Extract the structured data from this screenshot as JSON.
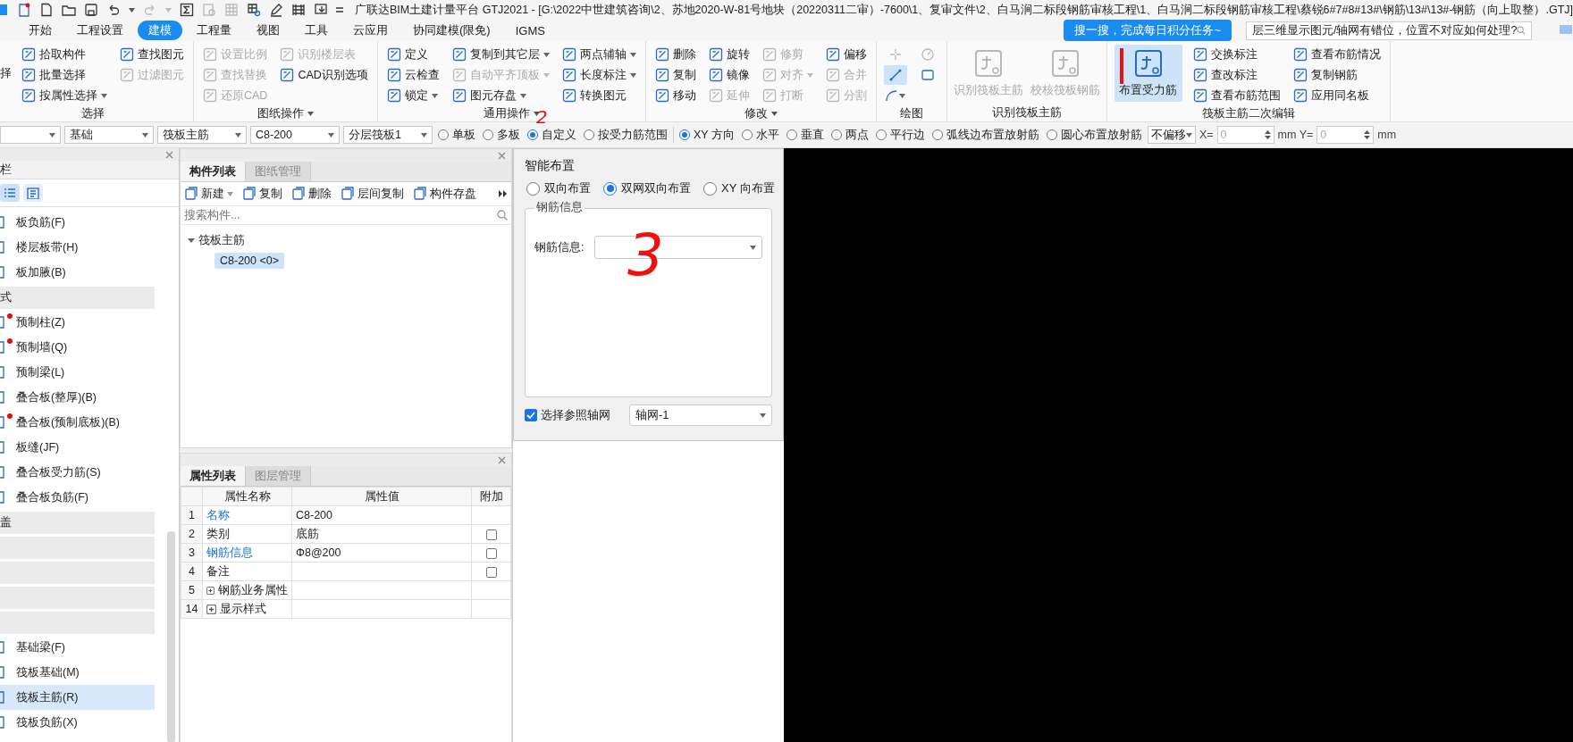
{
  "window": {
    "title": "广联达BIM土建计量平台 GTJ2021 - [G:\\2022中世建筑咨询\\2、苏地2020-W-81号地块（20220311二审）-7600\\1、复审文件\\2、白马涧二标段钢筋审核工程\\1、白马涧二标段钢筋审核工程\\蔡锐6#7#8#13#\\钢筋\\13#\\13#-钢筋（向上取整）.GTJ]"
  },
  "menu_tabs": [
    {
      "label": "开始",
      "selected": false
    },
    {
      "label": "工程设置",
      "selected": false
    },
    {
      "label": "建模",
      "selected": true
    },
    {
      "label": "工程量",
      "selected": false
    },
    {
      "label": "视图",
      "selected": false
    },
    {
      "label": "工具",
      "selected": false
    },
    {
      "label": "云应用",
      "selected": false
    },
    {
      "label": "协同建模(限免)",
      "selected": false
    },
    {
      "label": "IGMS",
      "selected": false
    }
  ],
  "tooltip": "搜一搜，完成每日积分任务~",
  "help_search": {
    "value": "层三维显示图元/轴网有错位，位置不对应如何处理?"
  },
  "ribbon": {
    "groups": [
      {
        "label": "选择",
        "menu": false,
        "columns": [
          [
            {
              "kind": "edge",
              "label": "择"
            }
          ],
          [
            {
              "kind": "small",
              "label": "拾取构件",
              "disabled": false,
              "dropdown": false
            },
            {
              "kind": "small",
              "label": "批量选择",
              "disabled": false,
              "dropdown": false
            },
            {
              "kind": "small",
              "label": "按属性选择",
              "disabled": false,
              "dropdown": true
            }
          ],
          [
            {
              "kind": "small",
              "label": "查找图元",
              "disabled": false,
              "dropdown": false
            },
            {
              "kind": "small",
              "label": "过滤图元",
              "disabled": true,
              "dropdown": false
            }
          ]
        ]
      },
      {
        "label": "图纸操作",
        "menu": true,
        "columns": [
          [
            {
              "kind": "small",
              "label": "设置比例",
              "disabled": true,
              "dropdown": false
            },
            {
              "kind": "small",
              "label": "查找替换",
              "disabled": true,
              "dropdown": false
            },
            {
              "kind": "small",
              "label": "还原CAD",
              "disabled": true,
              "dropdown": false
            }
          ],
          [
            {
              "kind": "small",
              "label": "识别楼层表",
              "disabled": true,
              "dropdown": false
            },
            {
              "kind": "small",
              "label": "CAD识别选项",
              "disabled": false,
              "dropdown": false
            }
          ]
        ]
      },
      {
        "label": "通用操作",
        "menu": true,
        "columns": [
          [
            {
              "kind": "small",
              "label": "定义",
              "disabled": false,
              "dropdown": false
            },
            {
              "kind": "small",
              "label": "云检查",
              "disabled": false,
              "dropdown": false
            },
            {
              "kind": "small",
              "label": "锁定",
              "disabled": false,
              "dropdown": true
            }
          ],
          [
            {
              "kind": "small",
              "label": "复制到其它层",
              "disabled": false,
              "dropdown": true
            },
            {
              "kind": "small",
              "label": "自动平齐顶板",
              "disabled": true,
              "dropdown": true
            },
            {
              "kind": "small",
              "label": "图元存盘",
              "disabled": false,
              "dropdown": true
            }
          ],
          [
            {
              "kind": "small",
              "label": "两点辅轴",
              "disabled": false,
              "dropdown": true
            },
            {
              "kind": "small",
              "label": "长度标注",
              "disabled": false,
              "dropdown": true
            },
            {
              "kind": "small",
              "label": "转换图元",
              "disabled": false,
              "dropdown": false
            }
          ]
        ]
      },
      {
        "label": "修改",
        "menu": true,
        "columns": [
          [
            {
              "kind": "small",
              "label": "删除",
              "disabled": false,
              "dropdown": false
            },
            {
              "kind": "small",
              "label": "复制",
              "disabled": false,
              "dropdown": false
            },
            {
              "kind": "small",
              "label": "移动",
              "disabled": false,
              "dropdown": false
            }
          ],
          [
            {
              "kind": "small",
              "label": "旋转",
              "disabled": false,
              "dropdown": false
            },
            {
              "kind": "small",
              "label": "镜像",
              "disabled": false,
              "dropdown": false
            },
            {
              "kind": "small",
              "label": "延伸",
              "disabled": true,
              "dropdown": false
            }
          ],
          [
            {
              "kind": "small",
              "label": "修剪",
              "disabled": true,
              "dropdown": false
            },
            {
              "kind": "small",
              "label": "对齐",
              "disabled": true,
              "dropdown": true
            },
            {
              "kind": "small",
              "label": "打断",
              "disabled": true,
              "dropdown": false
            }
          ],
          [
            {
              "kind": "small",
              "label": "偏移",
              "disabled": false,
              "dropdown": false
            },
            {
              "kind": "small",
              "label": "合并",
              "disabled": true,
              "dropdown": false
            },
            {
              "kind": "small",
              "label": "分割",
              "disabled": true,
              "dropdown": false
            }
          ]
        ]
      },
      {
        "label": "绘图",
        "menu": false,
        "columns": [
          [
            {
              "kind": "icon",
              "disabled": true,
              "selected": false,
              "dropdown": false
            },
            {
              "kind": "icon",
              "disabled": false,
              "selected": true,
              "dropdown": false
            },
            {
              "kind": "icon",
              "disabled": false,
              "selected": false,
              "dropdown": true
            }
          ],
          [
            {
              "kind": "icon",
              "disabled": true,
              "selected": false,
              "dropdown": false
            },
            {
              "kind": "icon",
              "disabled": false,
              "selected": false,
              "dropdown": false
            }
          ]
        ]
      },
      {
        "label": "识别筏板主筋",
        "menu": false,
        "columns": [
          [
            {
              "kind": "large",
              "label": "识别筏板主筋",
              "disabled": true,
              "selected": false,
              "marked": false
            }
          ],
          [
            {
              "kind": "large",
              "label": "校核筏板钢筋",
              "disabled": true,
              "selected": false,
              "marked": false
            }
          ]
        ]
      },
      {
        "label": "筏板主筋二次编辑",
        "menu": false,
        "columns": [
          [
            {
              "kind": "large",
              "label": "布置受力筋",
              "disabled": false,
              "selected": true,
              "marked": true
            }
          ],
          [
            {
              "kind": "small",
              "label": "交换标注",
              "disabled": false,
              "dropdown": false
            },
            {
              "kind": "small",
              "label": "查改标注",
              "disabled": false,
              "dropdown": false
            },
            {
              "kind": "small",
              "label": "查看布筋范围",
              "disabled": false,
              "dropdown": false
            }
          ],
          [
            {
              "kind": "small",
              "label": "查看布筋情况",
              "disabled": false,
              "dropdown": false
            },
            {
              "kind": "small",
              "label": "复制钢筋",
              "disabled": false,
              "dropdown": false
            },
            {
              "kind": "small",
              "label": "应用同名板",
              "disabled": false,
              "dropdown": false
            }
          ]
        ]
      }
    ]
  },
  "options_bar": [
    {
      "kind": "cut_dropdown"
    },
    {
      "kind": "dropdown",
      "value": "基础"
    },
    {
      "kind": "dropdown",
      "value": "筏板主筋"
    },
    {
      "kind": "dropdown",
      "value": "C8-200"
    },
    {
      "kind": "dropdown",
      "value": "分层筏板1"
    },
    {
      "kind": "radio",
      "label": "单板",
      "selected": false
    },
    {
      "kind": "radio",
      "label": "多板",
      "selected": false
    },
    {
      "kind": "radio",
      "label": "自定义",
      "selected": true,
      "annotation": "2"
    },
    {
      "kind": "radio",
      "label": "按受力筋范围",
      "selected": false
    },
    {
      "kind": "separator"
    },
    {
      "kind": "radio",
      "label": "XY 方向",
      "selected": true
    },
    {
      "kind": "radio",
      "label": "水平",
      "selected": false
    },
    {
      "kind": "radio",
      "label": "垂直",
      "selected": false
    },
    {
      "kind": "radio",
      "label": "两点",
      "selected": false
    },
    {
      "kind": "radio",
      "label": "平行边",
      "selected": false
    },
    {
      "kind": "radio",
      "label": "弧线边布置放射筋",
      "selected": false
    },
    {
      "kind": "radio",
      "label": "圆心布置放射筋",
      "selected": false
    },
    {
      "kind": "offset_dropdown",
      "value": "不偏移"
    },
    {
      "kind": "label",
      "label": "X="
    },
    {
      "kind": "number",
      "placeholder": "0"
    },
    {
      "kind": "label",
      "label": "mm Y="
    },
    {
      "kind": "number",
      "placeholder": "0"
    },
    {
      "kind": "label",
      "label": "mm"
    }
  ],
  "sidebar": {
    "title": "栏",
    "view_modes": [
      {
        "selected": true
      },
      {
        "selected": false
      }
    ],
    "items": [
      {
        "kind": "item",
        "label": "板负筋(F)",
        "flagged": false,
        "selected": false
      },
      {
        "kind": "item",
        "label": "楼层板带(H)",
        "flagged": false,
        "selected": false
      },
      {
        "kind": "item",
        "label": "板加腋(B)",
        "flagged": false,
        "selected": false
      },
      {
        "kind": "header",
        "label": "式"
      },
      {
        "kind": "item",
        "label": "预制柱(Z)",
        "flagged": true,
        "selected": false
      },
      {
        "kind": "item",
        "label": "预制墙(Q)",
        "flagged": true,
        "selected": false
      },
      {
        "kind": "item",
        "label": "预制梁(L)",
        "flagged": false,
        "selected": false
      },
      {
        "kind": "item",
        "label": "叠合板(整厚)(B)",
        "flagged": false,
        "selected": false
      },
      {
        "kind": "item",
        "label": "叠合板(预制底板)(B)",
        "flagged": true,
        "selected": false
      },
      {
        "kind": "item",
        "label": "板缝(JF)",
        "flagged": false,
        "selected": false
      },
      {
        "kind": "item",
        "label": "叠合板受力筋(S)",
        "flagged": false,
        "selected": false
      },
      {
        "kind": "item",
        "label": "叠合板负筋(F)",
        "flagged": false,
        "selected": false
      },
      {
        "kind": "header",
        "label": "盖"
      },
      {
        "kind": "header"
      },
      {
        "kind": "header"
      },
      {
        "kind": "header"
      },
      {
        "kind": "header"
      },
      {
        "kind": "item",
        "label": "基础梁(F)",
        "flagged": false,
        "selected": false
      },
      {
        "kind": "item",
        "label": "筏板基础(M)",
        "flagged": false,
        "selected": false
      },
      {
        "kind": "item",
        "label": "筏板主筋(R)",
        "flagged": false,
        "selected": true
      },
      {
        "kind": "item",
        "label": "筏板负筋(X)",
        "flagged": false,
        "selected": false
      }
    ]
  },
  "component_panel": {
    "tabs": [
      {
        "label": "构件列表",
        "selected": true
      },
      {
        "label": "图纸管理",
        "selected": false
      }
    ],
    "toolbar": [
      {
        "label": "新建",
        "dropdown": true
      },
      {
        "label": "复制",
        "dropdown": false
      },
      {
        "label": "删除",
        "dropdown": false
      },
      {
        "label": "层间复制",
        "dropdown": false
      },
      {
        "label": "构件存盘",
        "dropdown": false
      }
    ],
    "search": {
      "placeholder": "搜索构件..."
    },
    "tree": [
      {
        "label": "筏板主筋",
        "expanded": true,
        "selected": false,
        "children": [
          {
            "label": "C8-200 <0>",
            "selected": true
          }
        ]
      }
    ]
  },
  "property_panel": {
    "tabs": [
      {
        "label": "属性列表",
        "selected": true
      },
      {
        "label": "图层管理",
        "selected": false
      }
    ],
    "columns": [
      "属性名称",
      "属性值",
      "附加"
    ],
    "rows": [
      {
        "number": "1",
        "name": "名称",
        "value": "C8-200",
        "link": true,
        "expandable": false
      },
      {
        "number": "2",
        "name": "类别",
        "value": "底筋",
        "link": false,
        "expandable": false,
        "checked": false
      },
      {
        "number": "3",
        "name": "钢筋信息",
        "value": "Φ8@200",
        "link": true,
        "expandable": false,
        "checked": false
      },
      {
        "number": "4",
        "name": "备注",
        "link": false,
        "expandable": false,
        "checked": false
      },
      {
        "number": "5",
        "name": "钢筋业务属性",
        "expandable": true
      },
      {
        "number": "14",
        "name": "显示样式",
        "expandable": true
      }
    ]
  },
  "smart_layout": {
    "title": "智能布置",
    "options": [
      {
        "label": "双向布置",
        "selected": false
      },
      {
        "label": "双网双向布置",
        "selected": true
      },
      {
        "label": "XY 向布置",
        "selected": false
      }
    ],
    "group_title": "钢筋信息",
    "field_label": "钢筋信息:",
    "annotation": "3",
    "reference_axis": {
      "label": "选择参照轴网",
      "checked": true
    },
    "axis_value": "轴网-1"
  }
}
